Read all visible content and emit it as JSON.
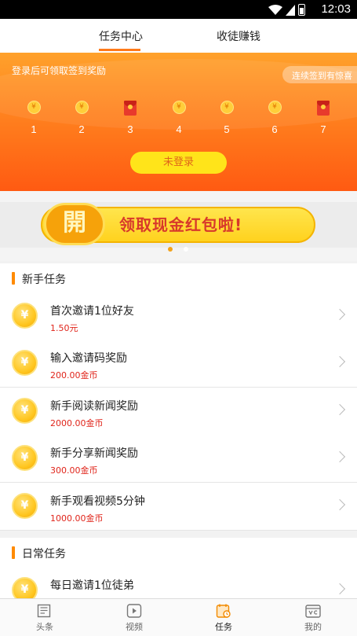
{
  "status_bar": {
    "time": "12:03",
    "icons": [
      "wifi-icon",
      "cell-signal-icon",
      "battery-icon"
    ]
  },
  "top_tabs": [
    {
      "label": "任务中心",
      "active": true
    },
    {
      "label": "收徒赚钱",
      "active": false
    }
  ],
  "signin": {
    "hint": "登录后可领取签到奖励",
    "surprise_label": "连续签到有惊喜",
    "days": [
      {
        "label": "1",
        "icon": "coin-icon",
        "coin_symbol": "¥"
      },
      {
        "label": "2",
        "icon": "coin-icon",
        "coin_symbol": "¥"
      },
      {
        "label": "3",
        "icon": "red-envelope-icon"
      },
      {
        "label": "4",
        "icon": "coin-icon",
        "coin_symbol": "¥"
      },
      {
        "label": "5",
        "icon": "coin-icon",
        "coin_symbol": "¥"
      },
      {
        "label": "6",
        "icon": "coin-icon",
        "coin_symbol": "¥"
      },
      {
        "label": "7",
        "icon": "red-envelope-icon"
      }
    ],
    "login_button": "未登录"
  },
  "promo": {
    "seal": "開",
    "text": "领取现金红包啦!",
    "pages": 2,
    "active_page": 1
  },
  "newbie": {
    "title": "新手任务",
    "coin_symbol": "¥",
    "tasks": [
      {
        "title": "首次邀请1位好友",
        "reward": "1.50元"
      },
      {
        "title": "输入邀请码奖励",
        "reward": "200.00金币"
      },
      {
        "title": "新手阅读新闻奖励",
        "reward": "2000.00金币"
      },
      {
        "title": "新手分享新闻奖励",
        "reward": "300.00金币"
      },
      {
        "title": "新手观看视频5分钟",
        "reward": "1000.00金币"
      }
    ]
  },
  "daily": {
    "title": "日常任务",
    "coin_symbol": "¥",
    "tasks": [
      {
        "title": "每日邀请1位徒弟",
        "reward": ""
      }
    ]
  },
  "bottom_nav": [
    {
      "label": "头条",
      "icon": "newspaper-icon",
      "active": false
    },
    {
      "label": "视频",
      "icon": "play-icon",
      "active": false
    },
    {
      "label": "任务",
      "icon": "task-calendar-icon",
      "active": true
    },
    {
      "label": "我的",
      "icon": "profile-card-icon",
      "active": false
    }
  ],
  "colors": {
    "accent": "#ff7a1a",
    "reward_red": "#e0251b",
    "banner_top": "#ffa12b",
    "banner_bottom": "#ff5a12"
  }
}
